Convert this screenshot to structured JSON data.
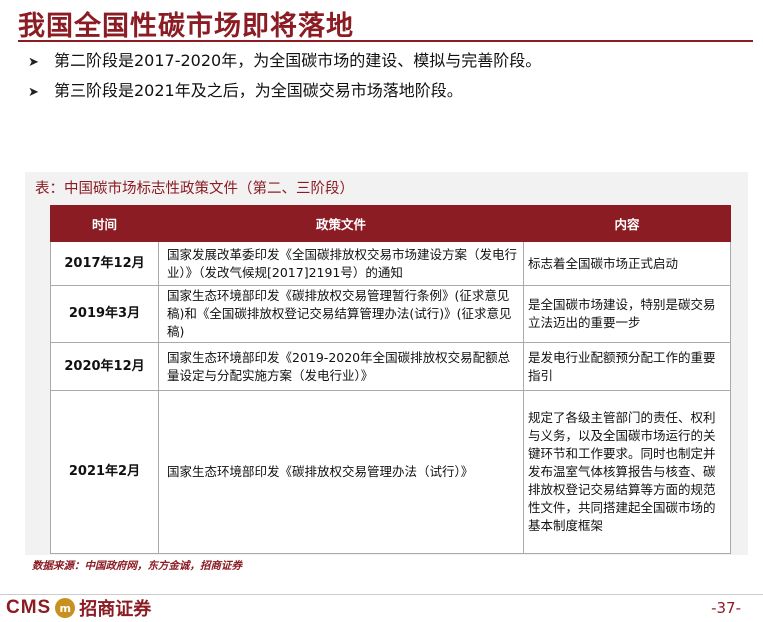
{
  "title": "我国全国性碳市场即将落地",
  "bullets": [
    "第二阶段是2017-2020年，为全国碳市场的建设、模拟与完善阶段。",
    "第三阶段是2021年及之后，为全国碳交易市场落地阶段。"
  ],
  "table": {
    "caption": "表：中国碳市场标志性政策文件（第二、三阶段）",
    "headers": [
      "时间",
      "政策文件",
      "内容"
    ],
    "rows": [
      {
        "time": "2017年12月",
        "doc": "国家发展改革委印发《全国碳排放权交易市场建设方案（发电行业）》（发改气候规[2017]2191号）的通知",
        "content": "标志着全国碳市场正式启动"
      },
      {
        "time": "2019年3月",
        "doc": "国家生态环境部印发《碳排放权交易管理暂行条例》(征求意见稿)和《全国碳排放权登记交易结算管理办法(试行)》(征求意见稿)",
        "content": "是全国碳市场建设，特别是碳交易立法迈出的重要一步"
      },
      {
        "time": "2020年12月",
        "doc": "国家生态环境部印发《2019-2020年全国碳排放权交易配额总量设定与分配实施方案（发电行业）》",
        "content": "是发电行业配额预分配工作的重要指引"
      },
      {
        "time": "2021年2月",
        "doc": "国家生态环境部印发《碳排放权交易管理办法（试行）》",
        "content": "规定了各级主管部门的责任、权利与义务，以及全国碳市场运行的关键环节和工作要求。同时也制定并发布温室气体核算报告与核查、碳排放权登记交易结算等方面的规范性文件，共同搭建起全国碳市场的基本制度框架"
      }
    ]
  },
  "source": "数据来源：中国政府网，东方金诚，招商证券",
  "footer": {
    "logo_latin": "CMS",
    "logo_badge": "m",
    "logo_cn": "招商证券",
    "page_number": "-37-"
  },
  "colors": {
    "accent": "#8b1c24",
    "panel": "#f2f2f2",
    "logo_badge": "#c8911f"
  }
}
